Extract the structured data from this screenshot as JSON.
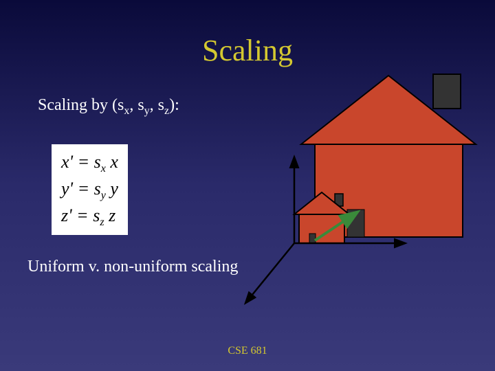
{
  "title": "Scaling",
  "subtitle_prefix": "Scaling by (s",
  "sub_x": "x",
  "subtitle_mid1": ", s",
  "sub_y": "y",
  "subtitle_mid2": ", s",
  "sub_z": "z",
  "subtitle_suffix": "):",
  "equations": {
    "row1": {
      "lhs": "x' = s",
      "sub": "x",
      "rhs": " x"
    },
    "row2": {
      "lhs": "y' = s",
      "sub": "y",
      "rhs": " y"
    },
    "row3": {
      "lhs": "z' = s",
      "sub": "z",
      "rhs": " z"
    }
  },
  "body_text": "Uniform v. non-uniform scaling",
  "footer": "CSE 681",
  "colors": {
    "house_fill": "#c9462c",
    "house_stroke": "#000000",
    "chimney_fill": "#333333",
    "axis_color": "#000000",
    "scale_arrow": "#3a8a3a"
  }
}
